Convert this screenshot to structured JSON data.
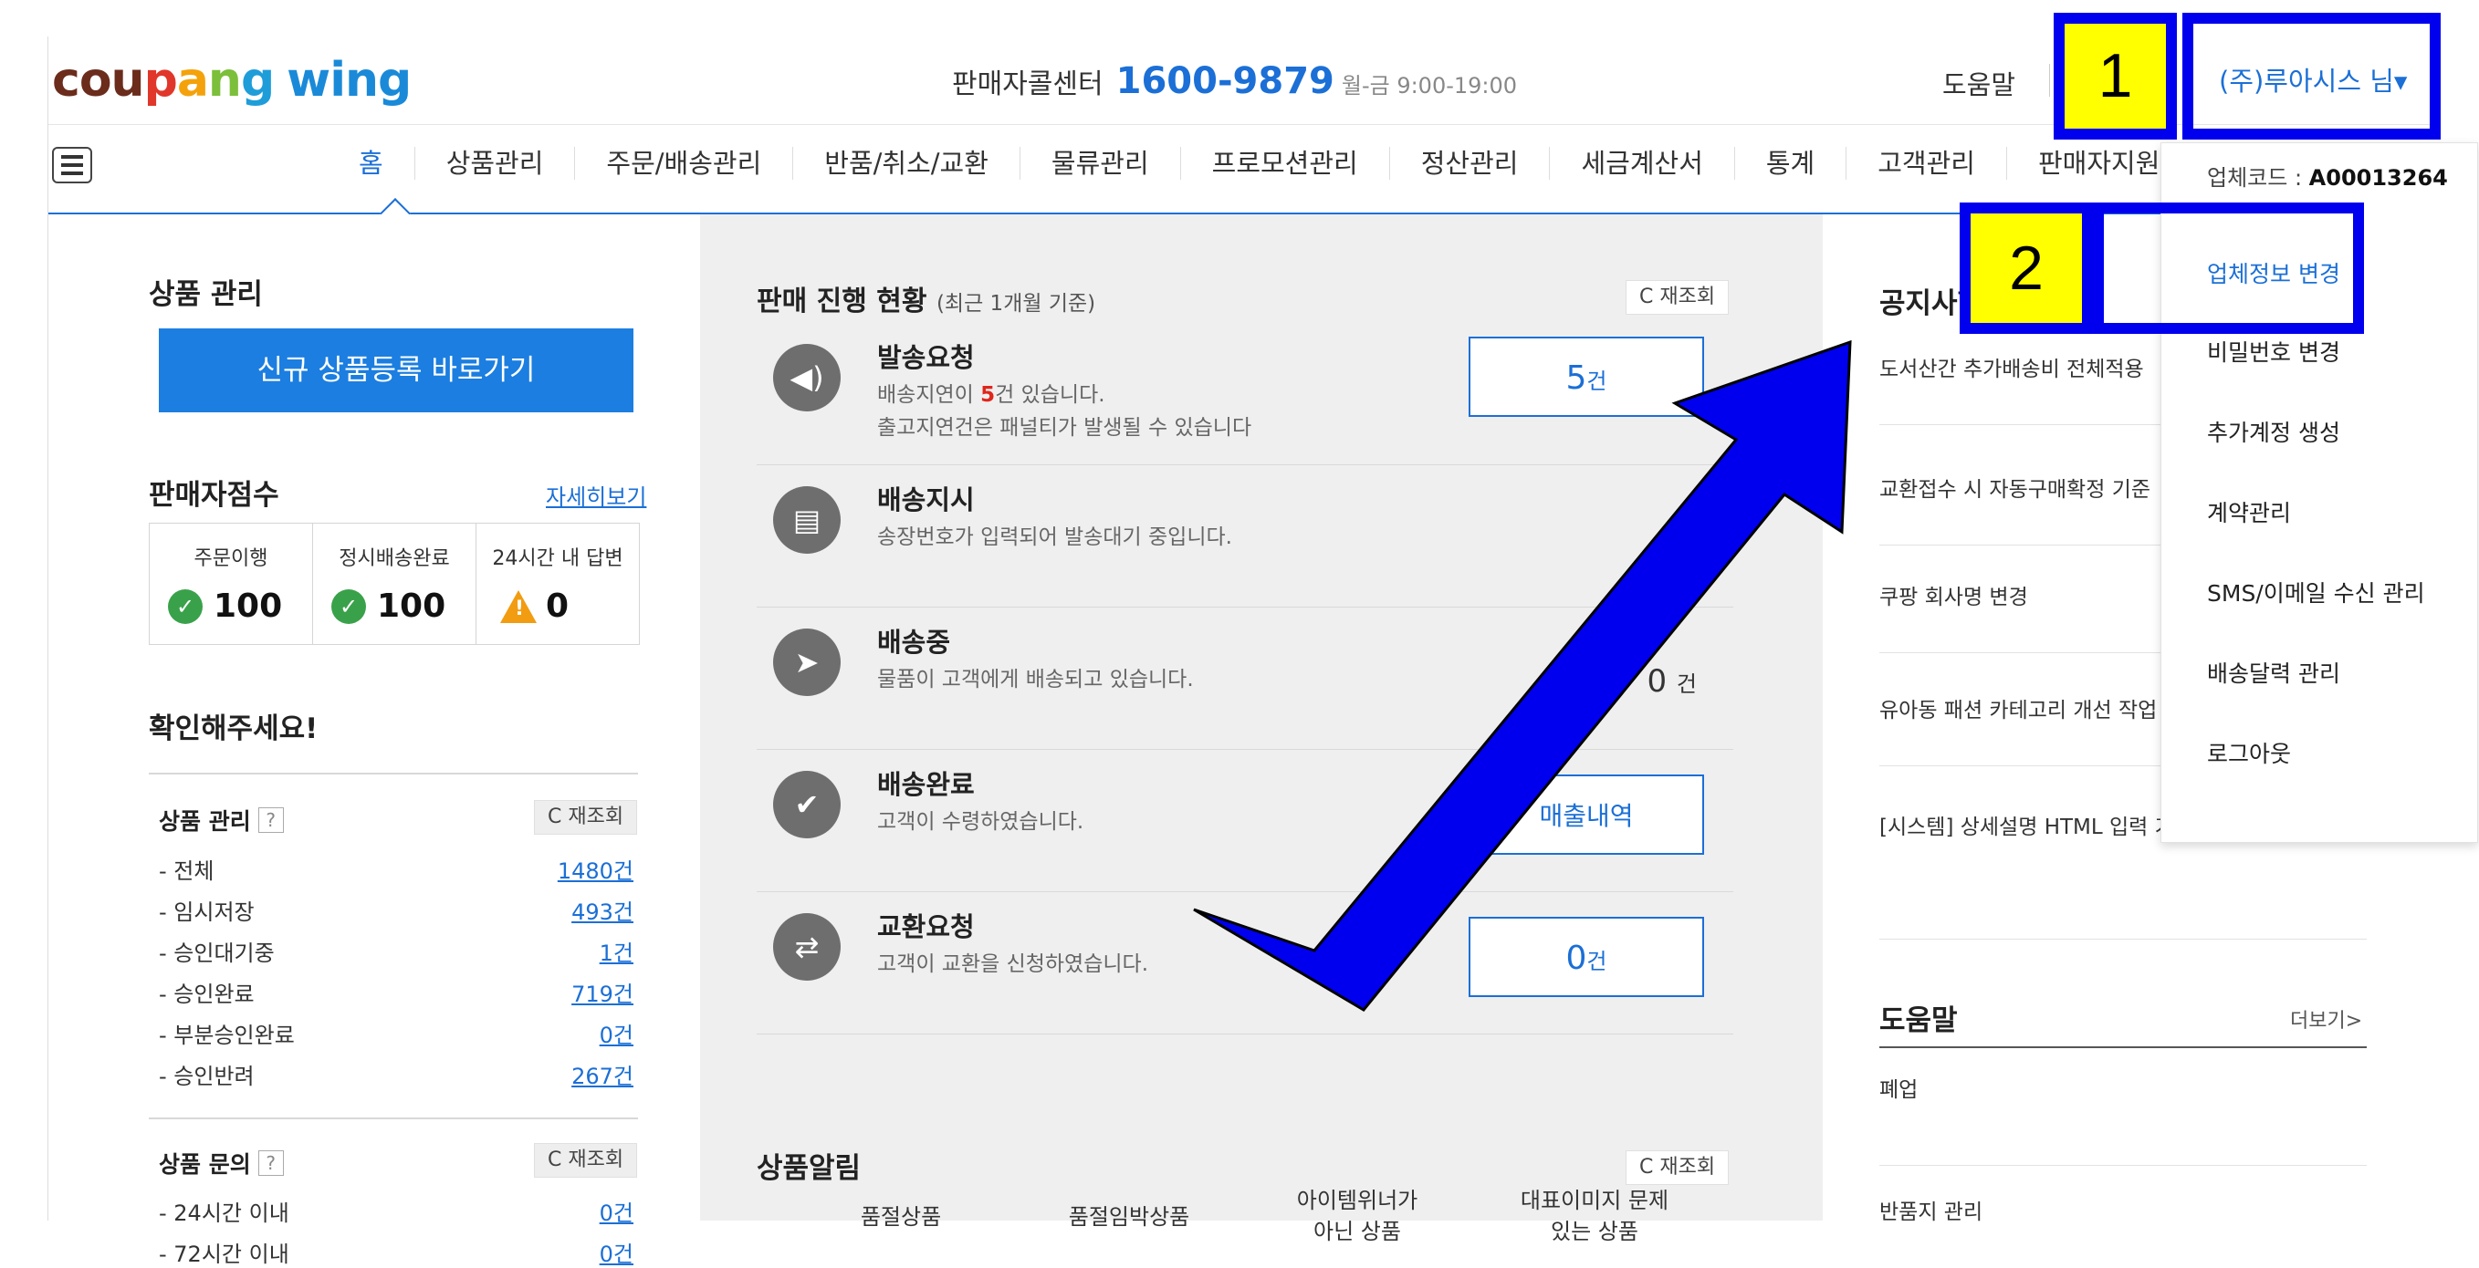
{
  "header": {
    "logo": {
      "c1": "cou",
      "c2": "p",
      "c3": "a",
      "c4": "n",
      "c5": "g",
      "wing": "wing"
    },
    "callcenter_label": "판매자콜센터",
    "phone": "1600-9879",
    "hours": "월-금 9:00-19:00",
    "help": "도움말",
    "user": "(주)루아시스 님▾"
  },
  "nav": {
    "items": [
      "홈",
      "상품관리",
      "주문/배송관리",
      "반품/취소/교환",
      "물류관리",
      "프로모션관리",
      "정산관리",
      "세금계산서",
      "통계",
      "고객관리",
      "판매자지원"
    ]
  },
  "left": {
    "product_mgmt_title": "상품 관리",
    "register_button": "신규 상품등록 바로가기",
    "score_title": "판매자점수",
    "score_more": "자세히보기",
    "scores": [
      {
        "label": "주문이행",
        "value": "100",
        "status": "ok"
      },
      {
        "label": "정시배송완료",
        "value": "100",
        "status": "ok"
      },
      {
        "label": "24시간 내 답변",
        "value": "0",
        "status": "warn"
      }
    ],
    "check_title": "확인해주세요!",
    "product_section": {
      "title": "상품 관리",
      "refresh": "C 재조회",
      "rows": [
        {
          "label": "- 전체",
          "value": "1480건"
        },
        {
          "label": "- 임시저장",
          "value": "493건"
        },
        {
          "label": "- 승인대기중",
          "value": "1건"
        },
        {
          "label": "- 승인완료",
          "value": "719건"
        },
        {
          "label": "- 부분승인완료",
          "value": "0건"
        },
        {
          "label": "- 승인반려",
          "value": "267건"
        }
      ]
    },
    "inquiry_section": {
      "title": "상품 문의",
      "refresh": "C 재조회",
      "rows": [
        {
          "label": "- 24시간 이내",
          "value": "0건"
        },
        {
          "label": "- 72시간 이내",
          "value": "0건"
        }
      ]
    }
  },
  "middle": {
    "title": "판매 진행 현황",
    "title_sub": "(최근 1개월 기준)",
    "refresh": "C 재조회",
    "statuses": [
      {
        "name": "발송요청",
        "desc1_pre": "배송지연이 ",
        "desc1_red": "5",
        "desc1_post": "건 있습니다.",
        "desc2": "출고지연건은 패널티가 발생될 수 있습니다",
        "count": "5",
        "unit": "건",
        "icon": "◀)"
      },
      {
        "name": "배송지시",
        "desc1": "송장번호가 입력되어 발송대기 중입니다.",
        "icon": "▤"
      },
      {
        "name": "배송중",
        "desc1": "물품이 고객에게 배송되고 있습니다.",
        "count": "0",
        "unit": "건",
        "icon": "➤"
      },
      {
        "name": "배송완료",
        "desc1": "고객이 수령하였습니다.",
        "button": "매출내역",
        "icon": "✔"
      },
      {
        "name": "교환요청",
        "desc1": "고객이 교환을 신청하였습니다.",
        "count": "0",
        "unit": "건",
        "icon": "⇄"
      }
    ],
    "alerts_title": "상품알림",
    "alerts_refresh": "C 재조회",
    "alerts": [
      {
        "line1": "품절상품",
        "line2": ""
      },
      {
        "line1": "품절임박상품",
        "line2": ""
      },
      {
        "line1": "아이템위너가",
        "line2": "아닌 상품"
      },
      {
        "line1": "대표이미지 문제",
        "line2": "있는 상품"
      }
    ]
  },
  "right": {
    "notice_title": "공지사항",
    "notices": [
      "도서산간 추가배송비 전체적용",
      "교환접수 시 자동구매확정 기준",
      "쿠팡 회사명 변경",
      "유아동 패션 카테고리 개선 작업",
      "[시스템] 상세설명 HTML 입력 기능 추가 안내"
    ],
    "help_title": "도움말",
    "help_more": "더보기>",
    "help_items": [
      "폐업",
      "반품지 관리"
    ]
  },
  "dropdown": {
    "code_label": "업체코드 : ",
    "code_value": "A00013264",
    "items": [
      "업체정보 변경",
      "비밀번호 변경",
      "추가계정 생성",
      "계약관리",
      "SMS/이메일 수신 관리",
      "배송달력 관리",
      "로그아웃"
    ]
  },
  "annotations": {
    "one": "1",
    "two": "2"
  },
  "colors": {
    "annotation_blue": "#0000ee",
    "annotation_yellow": "#ffff00",
    "accent": "#1b6fd6"
  }
}
